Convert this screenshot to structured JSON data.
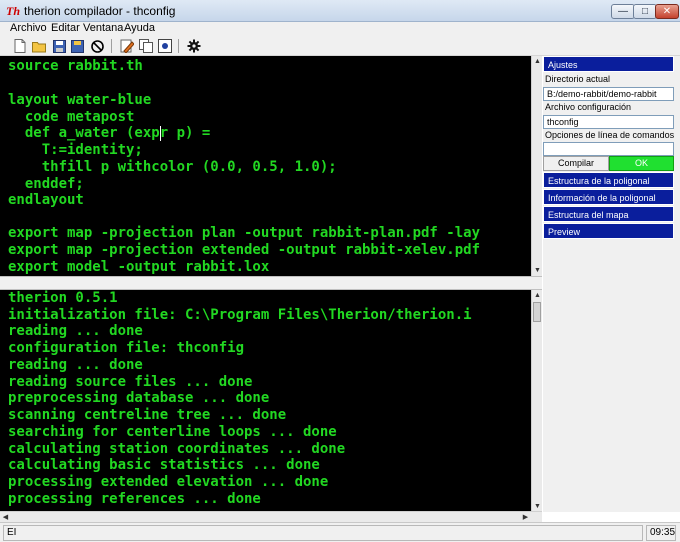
{
  "window": {
    "app_icon": "Th",
    "title": "therion compilador - thconfig",
    "controls": [
      "minimize",
      "maximize",
      "close"
    ]
  },
  "menu": [
    "Archivo",
    "Editar",
    "Ventana",
    "Ayuda"
  ],
  "toolbar": {
    "icons": [
      "new-file-icon",
      "open-folder-icon",
      "save-icon",
      "save-all-icon",
      "stop-icon",
      "edit-icon",
      "copy-icon",
      "compile-icon",
      "settings-icon"
    ]
  },
  "editor": {
    "lines": [
      "source rabbit.th",
      "",
      "layout water-blue",
      "  code metapost",
      "  def a_water (expr p) =",
      "    T:=identity;",
      "    thfill p withcolor (0.0, 0.5, 1.0);",
      "  enddef;",
      "endlayout",
      "",
      "export map -projection plan -output rabbit-plan.pdf -lay",
      "export map -projection extended -output rabbit-xelev.pdf",
      "export model -output rabbit.lox"
    ]
  },
  "console": {
    "lines": [
      "therion 0.5.1",
      "initialization file: C:\\Program Files\\Therion/therion.i",
      "reading ... done",
      "configuration file: thconfig",
      "reading ... done",
      "reading source files ... done",
      "preprocessing database ... done",
      "scanning centreline tree ... done",
      "searching for centerline loops ... done",
      "calculating station coordinates ... done",
      "calculating basic statistics ... done",
      "processing extended elevation ... done",
      "processing references ... done"
    ]
  },
  "settings": {
    "header": "Ajustes",
    "current_dir_label": "Directorio actual",
    "current_dir_value": "B:/demo-rabbit/demo-rabbit",
    "config_file_label": "Archivo configuración",
    "config_file_value": "thconfig",
    "cmdline_label": "Opciones de línea de comandos",
    "cmdline_value": "",
    "compile_label": "Compilar",
    "ok_label": "OK"
  },
  "panels": [
    "Estructura de la poligonal",
    "Información de la poligonal",
    "Estructura del mapa",
    "Preview"
  ],
  "statusbar": {
    "mode": "EI",
    "time": "09:35"
  },
  "colors": {
    "code_text": "#22d822",
    "code_bg": "#000000",
    "panel_header": "#0a1e9c",
    "ok_button": "#20e030"
  }
}
